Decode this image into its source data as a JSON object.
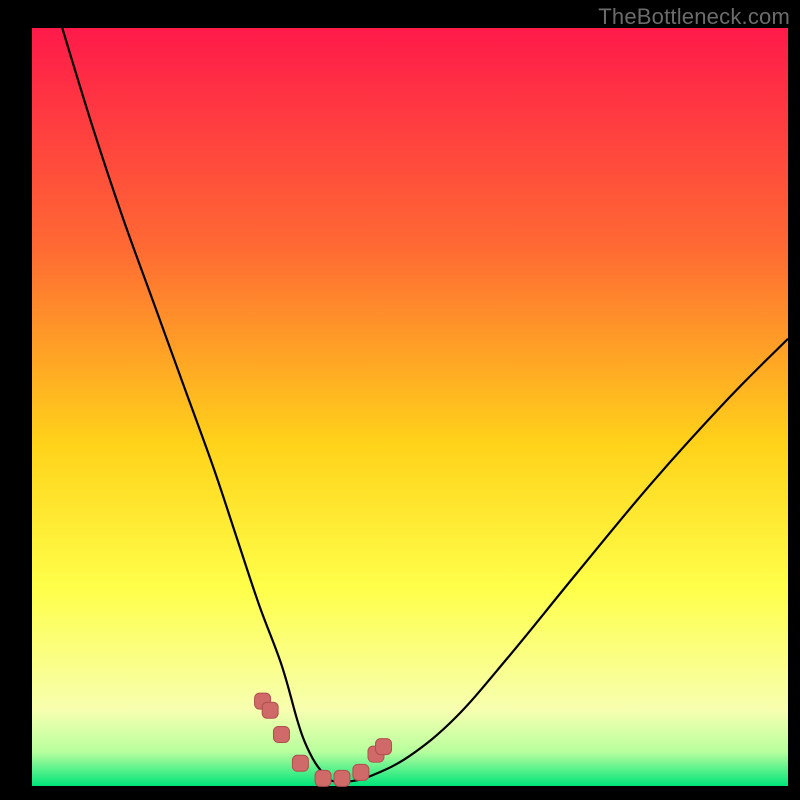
{
  "watermark": "TheBottleneck.com",
  "colors": {
    "frame_bg": "#000000",
    "gradient": {
      "top": "#ff1a4a",
      "t25": "#ff6a33",
      "mid": "#ffd31a",
      "t70": "#ffff4a",
      "t88": "#f7ffb0",
      "t94": "#b8ff9e",
      "bottom": "#00e47a"
    },
    "curve_stroke": "#000000",
    "marker_fill": "#cf6a68",
    "marker_stroke": "#b04f4e"
  },
  "chart_data": {
    "type": "line",
    "title": "",
    "xlabel": "",
    "ylabel": "",
    "xlim": [
      0,
      100
    ],
    "ylim": [
      0,
      100
    ],
    "series": [
      {
        "name": "bottleneck-curve",
        "x": [
          4,
          8,
          12,
          16,
          20,
          24,
          27,
          30,
          33,
          35,
          36,
          37.5,
          39,
          40,
          42,
          45,
          50,
          56,
          63,
          72,
          82,
          92,
          100
        ],
        "values": [
          100,
          87,
          75,
          64,
          53,
          42,
          33,
          24,
          16,
          9,
          6,
          3,
          1.2,
          0.6,
          0.6,
          1.4,
          4,
          9,
          17,
          28,
          40,
          51,
          59
        ]
      }
    ],
    "markers": {
      "name": "highlighted-points",
      "x": [
        30.5,
        31.5,
        33,
        35.5,
        38.5,
        41,
        43.5,
        45.5,
        46.5
      ],
      "values": [
        11.2,
        10,
        6.8,
        3,
        1,
        1,
        1.8,
        4.2,
        5.2
      ]
    }
  }
}
